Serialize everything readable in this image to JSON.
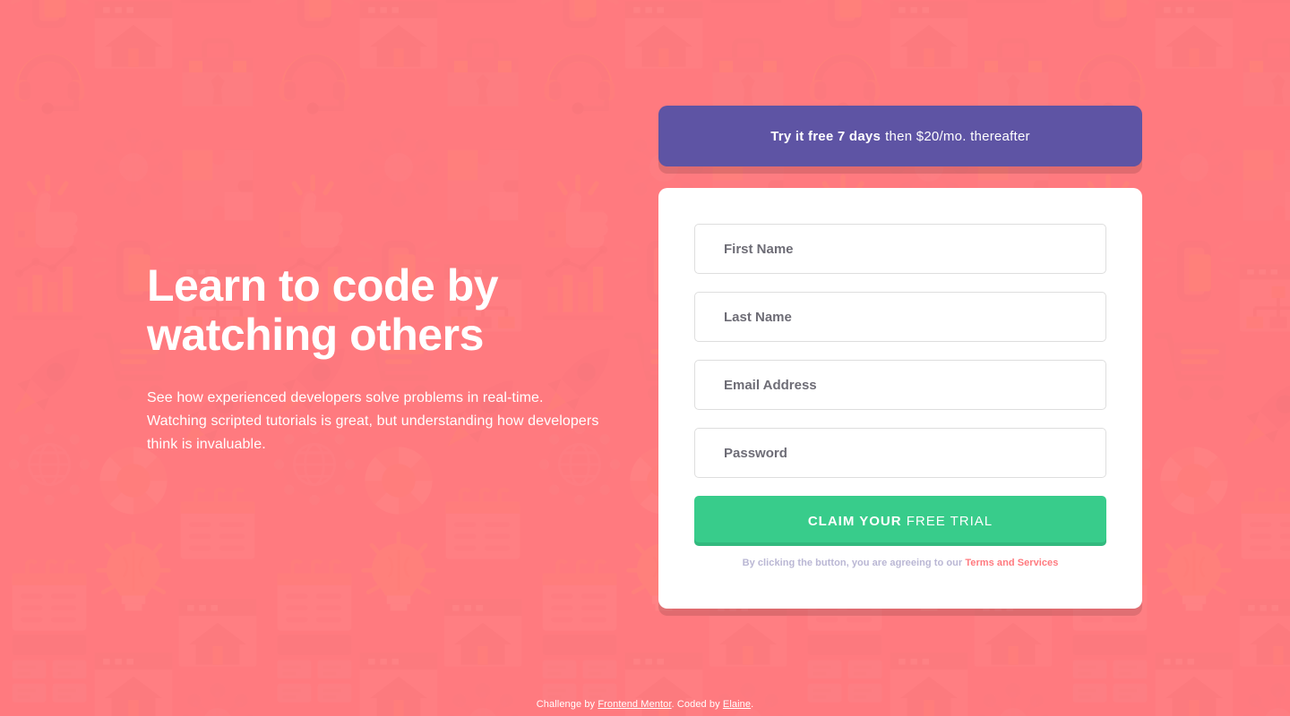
{
  "colors": {
    "background": "#FF7A7F",
    "banner": "#5E54A4",
    "cta": "#38CC8B",
    "terms_link": "#FF7A7F",
    "terms_text": "#BAB7D4",
    "input_border": "#DEDEDE",
    "input_text": "#3D3B48",
    "card": "#FFFFFF"
  },
  "hero": {
    "title": "Learn to code by watching others",
    "description": "See how experienced developers solve problems in real-time. Watching scripted tutorials is great, but understanding how developers think is invaluable."
  },
  "promo_banner": {
    "strong_text": "Try it free 7 days",
    "rest_text": "then $20/mo. thereafter"
  },
  "form": {
    "fields": [
      {
        "name": "first-name",
        "placeholder": "First Name",
        "value": "",
        "type": "text"
      },
      {
        "name": "last-name",
        "placeholder": "Last Name",
        "value": "",
        "type": "text"
      },
      {
        "name": "email",
        "placeholder": "Email Address",
        "value": "",
        "type": "email"
      },
      {
        "name": "password",
        "placeholder": "Password",
        "value": "",
        "type": "password"
      }
    ],
    "cta": {
      "strong_text": "CLAIM YOUR",
      "light_text": "FREE TRIAL"
    },
    "terms": {
      "prefix": "By clicking the button, you are agreeing to our ",
      "link_text": "Terms and Services"
    }
  },
  "attribution": {
    "prefix": "Challenge by ",
    "link1_text": "Frontend Mentor",
    "middle": ". Coded by ",
    "link2_text": "Elaine",
    "suffix": "."
  },
  "background_pattern": {
    "description": "repeating faded flat illustration icons on coral",
    "icons": [
      "smartphone-link-icon",
      "headset-icon",
      "thumbs-up-icon",
      "bar-chart-icon",
      "rocket-icon",
      "globe-gear-icon",
      "calendar-icon",
      "browser-window-icon",
      "browser-home-icon",
      "network-node-icon",
      "shopping-cart-icon",
      "lifebuoy-icon",
      "lightbulb-icon",
      "toolbox-icon",
      "puzzle-icon",
      "sitemap-icon"
    ]
  }
}
